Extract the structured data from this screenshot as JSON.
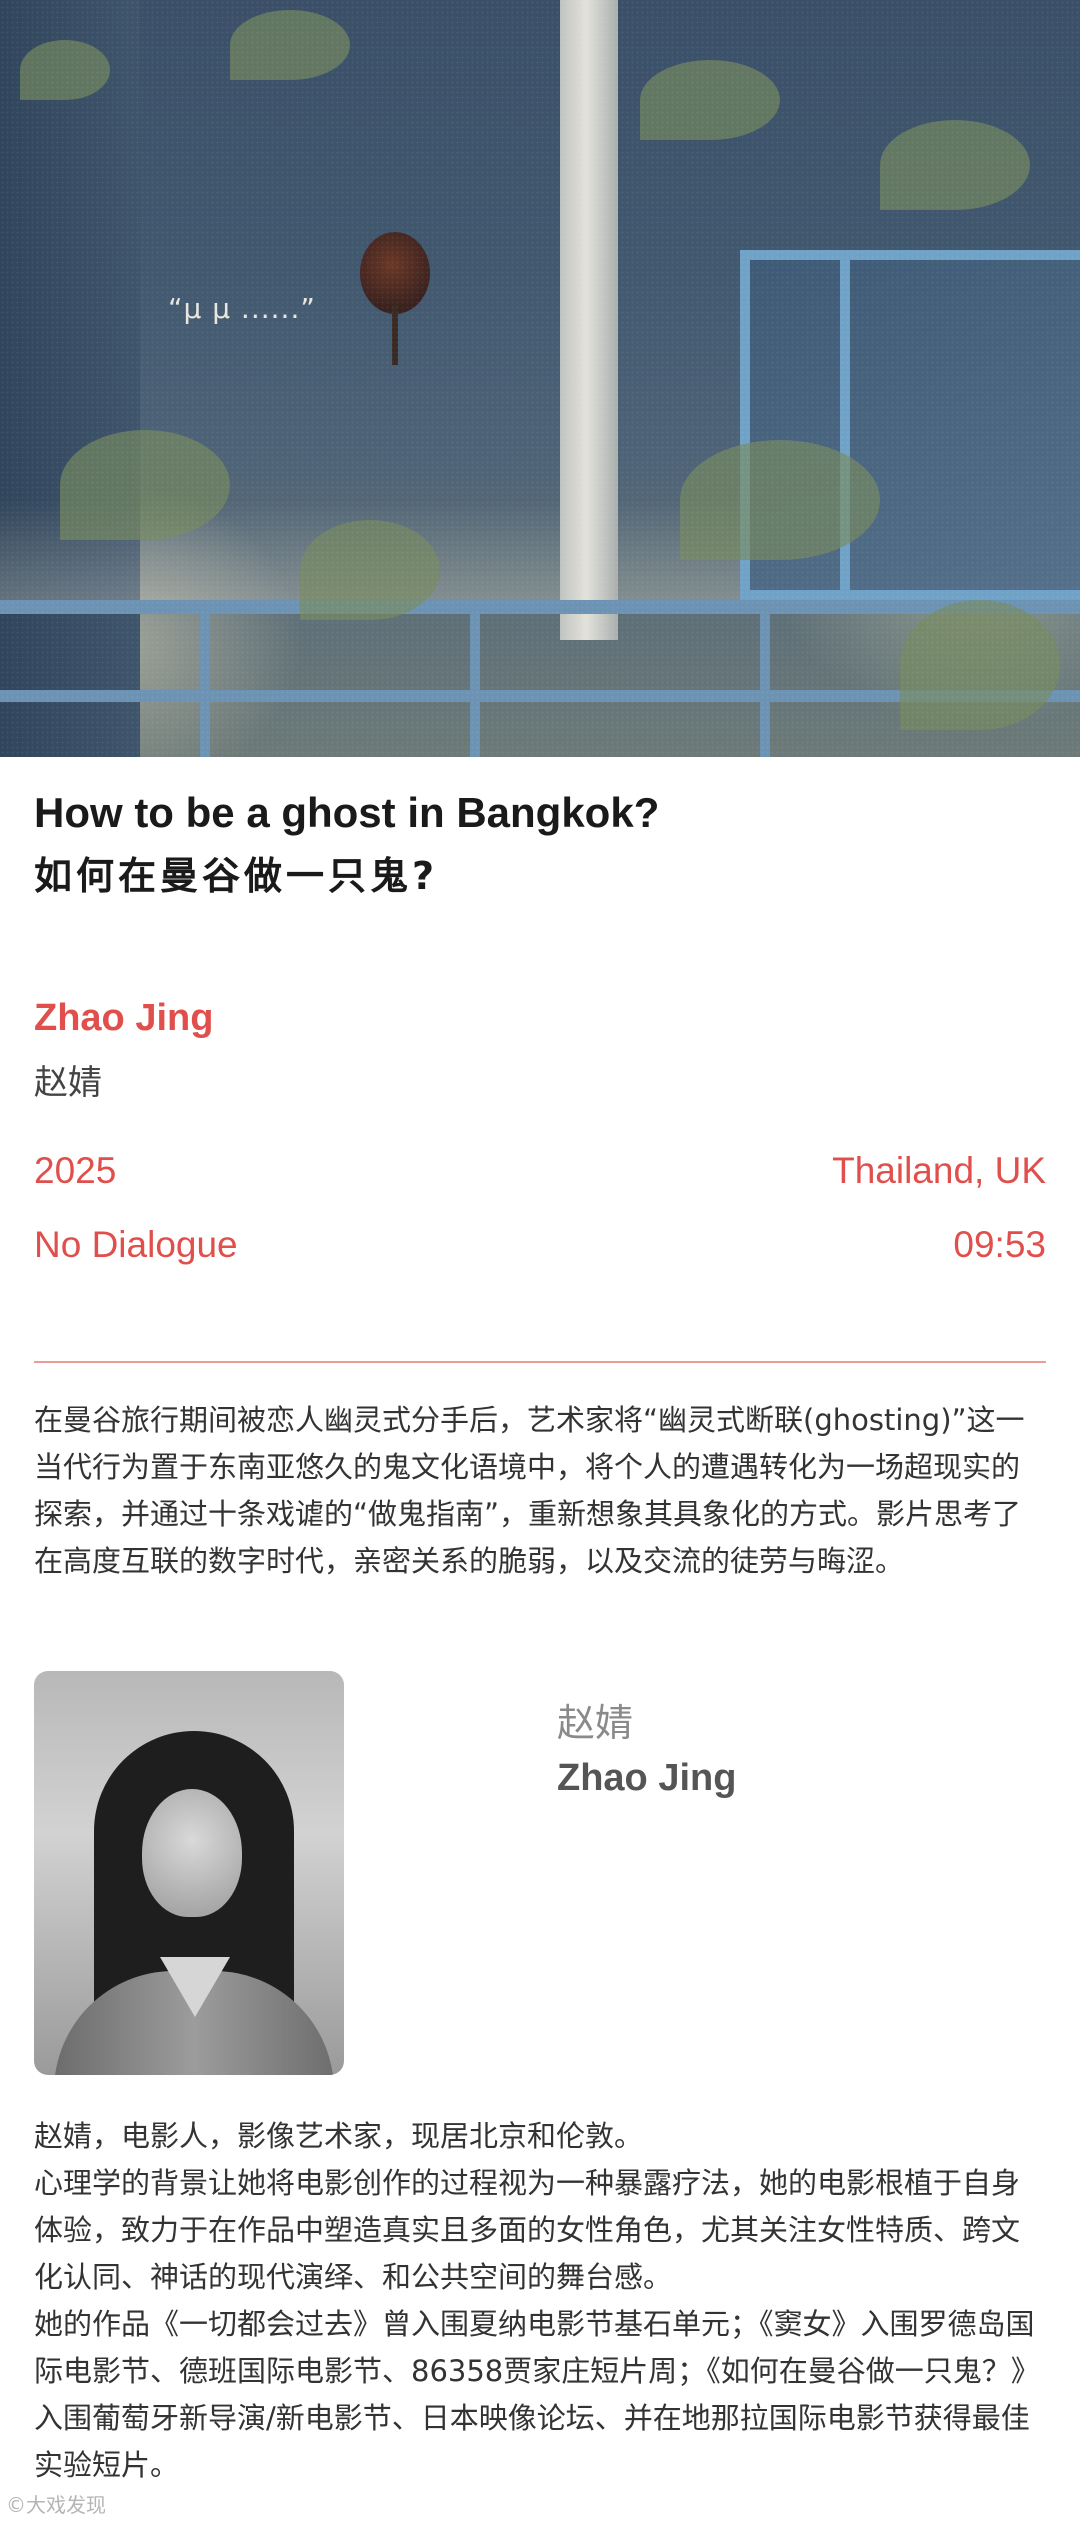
{
  "hero": {
    "subtitle": "“μ μ ......”"
  },
  "film": {
    "title_en": "How to be a ghost in Bangkok?",
    "title_zh": "如何在曼谷做一只鬼?",
    "director_en": "Zhao Jing",
    "director_zh": "赵婧",
    "year": "2025",
    "country": "Thailand, UK",
    "dialogue": "No Dialogue",
    "runtime": "09:53",
    "synopsis": "在曼谷旅行期间被恋人幽灵式分手后，艺术家将“幽灵式断联(ghosting)”这一当代行为置于东南亚悠久的鬼文化语境中，将个人的遭遇转化为一场超现实的探索，并通过十条戏谑的“做鬼指南”，重新想象其具象化的方式。影片思考了在高度互联的数字时代，亲密关系的脆弱，以及交流的徒劳与晦涩。"
  },
  "director_card": {
    "name_zh": "赵婧",
    "name_en": "Zhao Jing",
    "bio_line1": "赵婧，电影人，影像艺术家，现居北京和伦敦。",
    "bio_line2": "心理学的背景让她将电影创作的过程视为一种暴露疗法，她的电影根植于自身体验，致力于在作品中塑造真实且多面的女性角色，尤其关注女性特质、跨文化认同、神话的现代演绎、和公共空间的舞台感。",
    "bio_line3": "她的作品《一切都会过去》曾入围夏纳电影节基石单元；《窦女》入围罗德岛国际电影节、德班国际电影节、86358贾家庄短片周；《如何在曼谷做一只鬼？》入围葡萄牙新导演/新电影节、日本映像论坛、并在地那拉国际电影节获得最佳实验短片。"
  },
  "watermark": "©大戏发现",
  "colors": {
    "accent": "#e04f4b",
    "divider": "#ee9a95",
    "text": "#333333"
  }
}
